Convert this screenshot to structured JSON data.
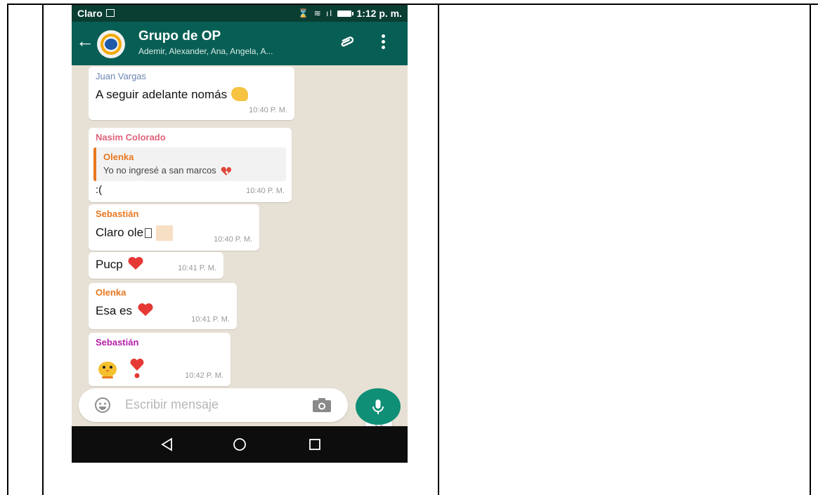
{
  "status_bar": {
    "carrier": "Claro",
    "time": "1:12 p. m."
  },
  "chat_header": {
    "title": "Grupo de OP",
    "subtitle": "Ademir, Alexander, Ana, Angela, A..."
  },
  "messages": [
    {
      "sender": "Juan Vargas",
      "sender_color": "#6b86b3",
      "text": "A seguir adelante nomás",
      "time": "10:40 P. M."
    },
    {
      "sender": "Nasim Colorado",
      "sender_color": "#e0637a",
      "quote": {
        "sender": "Olenka",
        "text": "Yo no ingresé a san marcos"
      },
      "text": ":(",
      "time": "10:40 P. M."
    },
    {
      "sender": "Sebastián",
      "sender_color": "#e8771f",
      "text": "Claro ole",
      "time": "10:40 P. M."
    },
    {
      "text": "Pucp",
      "time": "10:41 P. M."
    },
    {
      "sender": "Olenka",
      "sender_color": "#e8771f",
      "text": "Esa es",
      "time": "10:41 P. M."
    },
    {
      "sender": "Sebastián",
      "sender_color": "#b51ea8",
      "text": "",
      "time": "10:42 P. M."
    }
  ],
  "composer": {
    "placeholder": "Escribir mensaje"
  },
  "colors": {
    "header": "#075e54",
    "statusbar": "#0a3e33",
    "mic_button": "#0f8f76",
    "chat_background": "#e7e0d4"
  },
  "icons": [
    "back-arrow-icon",
    "group-avatar-icon",
    "attach-icon",
    "more-options-icon",
    "scroll-down-icon",
    "emoji-icon",
    "camera-icon",
    "microphone-icon",
    "nav-back-icon",
    "nav-home-icon",
    "nav-recents-icon"
  ]
}
